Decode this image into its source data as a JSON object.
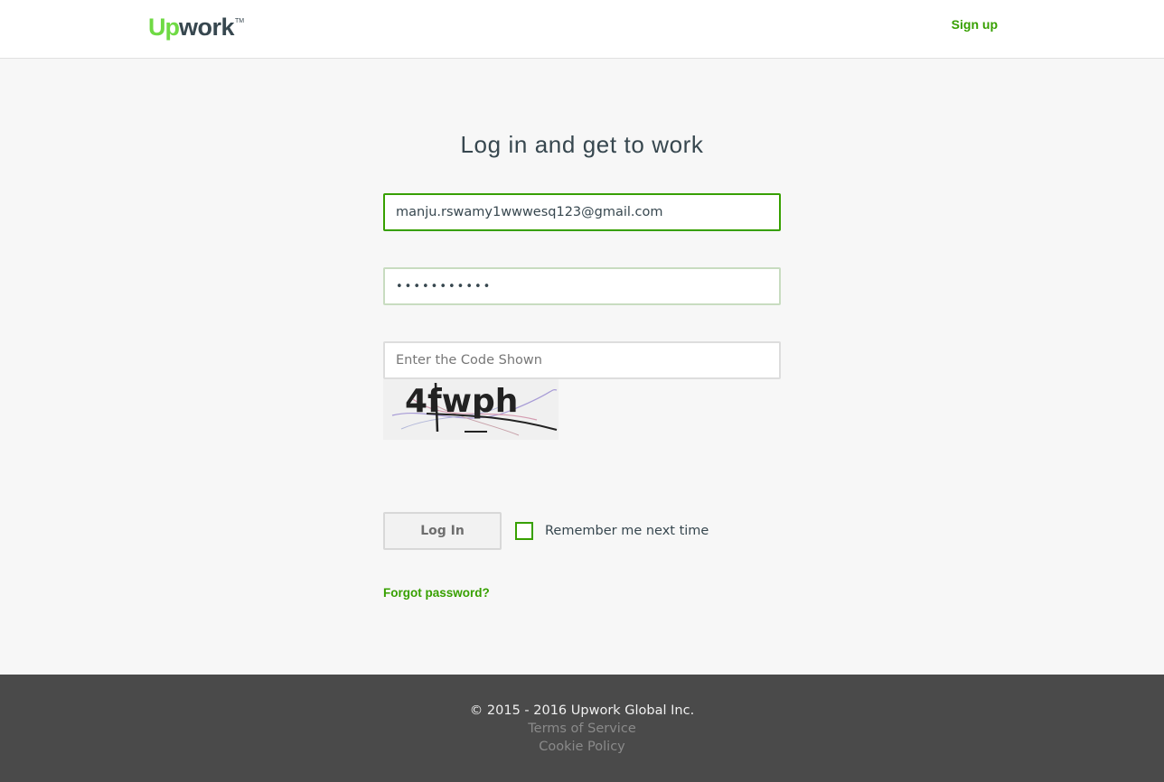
{
  "header": {
    "logo_up": "Up",
    "logo_work": "work",
    "logo_tm": "TM",
    "signup_label": "Sign up"
  },
  "main": {
    "title": "Log in and get to work",
    "email_value": "manju.rswamy1wwwesq123@gmail.com",
    "password_value": "•••••••••••",
    "code_placeholder": "Enter the Code Shown",
    "captcha_text": "4fwph",
    "login_label": "Log In",
    "remember_label": "Remember me next time",
    "remember_checked": false,
    "forgot_label": "Forgot password?"
  },
  "footer": {
    "copyright": "© 2015 - 2016 Upwork Global Inc.",
    "terms": "Terms of Service",
    "cookie": "Cookie Policy"
  },
  "colors": {
    "brand_green": "#6fda44",
    "link_green": "#37a000",
    "footer_bg": "#4a4a4a"
  }
}
